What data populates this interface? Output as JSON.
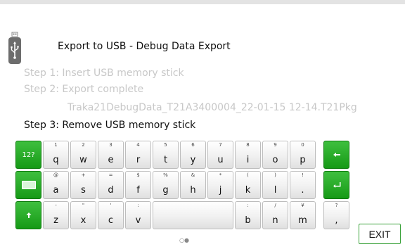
{
  "header": {
    "title": "Export to USB - Debug Data Export",
    "usb_icon": "usb-stick-icon"
  },
  "steps": {
    "step1": "Step 1: Insert USB memory stick",
    "step2": "Step 2: Export complete",
    "filename": "Traka21DebugData_T21A3400004_22-01-15 12-14.T21Pkg",
    "step3": "Step 3: Remove USB memory stick"
  },
  "keyboard": {
    "row1": [
      {
        "p": "q",
        "s": "1"
      },
      {
        "p": "w",
        "s": "2"
      },
      {
        "p": "e",
        "s": "3"
      },
      {
        "p": "r",
        "s": "4"
      },
      {
        "p": "t",
        "s": "5"
      },
      {
        "p": "y",
        "s": "6"
      },
      {
        "p": "u",
        "s": "7"
      },
      {
        "p": "i",
        "s": "8"
      },
      {
        "p": "o",
        "s": "9"
      },
      {
        "p": "p",
        "s": "0"
      }
    ],
    "row2": [
      {
        "p": "a",
        "s": "@"
      },
      {
        "p": "s",
        "s": "+"
      },
      {
        "p": "d",
        "s": "="
      },
      {
        "p": "f",
        "s": "$"
      },
      {
        "p": "g",
        "s": "%"
      },
      {
        "p": "h",
        "s": "&"
      },
      {
        "p": "j",
        "s": "*"
      },
      {
        "p": "k",
        "s": "("
      },
      {
        "p": "l",
        "s": ")"
      },
      {
        "p": ".",
        "s": "!"
      }
    ],
    "row3_left": [
      {
        "p": "z",
        "s": "-"
      },
      {
        "p": "x",
        "s": "\""
      },
      {
        "p": "c",
        "s": "'"
      },
      {
        "p": "v",
        "s": ":"
      }
    ],
    "row3_right": [
      {
        "p": "b",
        "s": ":"
      },
      {
        "p": "n",
        "s": "/"
      },
      {
        "p": "m",
        "s": "¥"
      },
      {
        "p": ",",
        "s": "?"
      }
    ],
    "mode_key": "12?",
    "backspace_icon": "backspace-arrow-icon",
    "enter_icon": "enter-arrow-icon",
    "keyboard_icon": "keyboard-icon",
    "shift_icon": "shift-arrow-icon"
  },
  "pager": "○●",
  "footer": {
    "exit_label": "EXIT"
  },
  "colors": {
    "green": "#1fa71f",
    "muted": "#c8c8c8"
  }
}
